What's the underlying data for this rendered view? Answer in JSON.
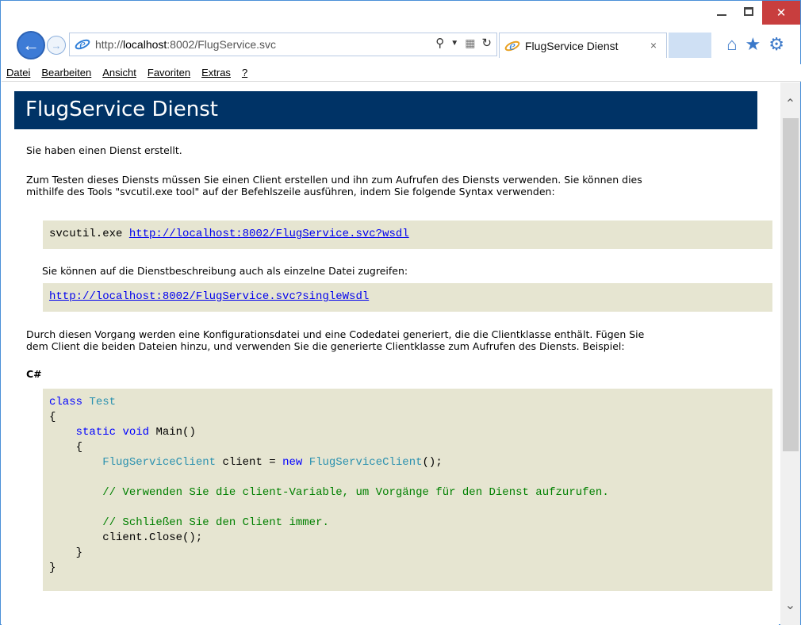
{
  "browser": {
    "address": {
      "prefix": "http://",
      "host": "localhost",
      "rest": ":8002/FlugService.svc"
    },
    "tab_title": "FlugService Dienst",
    "tab_close": "×",
    "menu": [
      "Datei",
      "Bearbeiten",
      "Ansicht",
      "Favoriten",
      "Extras",
      "?"
    ],
    "window_close": "✕"
  },
  "page": {
    "heading": "FlugService Dienst",
    "intro": "Sie haben einen Dienst erstellt.",
    "instructions_line1": "Zum Testen dieses Diensts müssen Sie einen Client erstellen und ihn zum Aufrufen des Diensts verwenden. Sie können dies",
    "instructions_line2": "mithilfe des Tools \"svcutil.exe tool\" auf der Befehlszeile ausführen, indem Sie folgende Syntax verwenden:",
    "svcutil_cmd": "svcutil.exe ",
    "wsdl_link": "http://localhost:8002/FlugService.svc?wsdl",
    "single_file_note": "Sie können auf die Dienstbeschreibung auch als einzelne Datei zugreifen:",
    "single_wsdl_link": "http://localhost:8002/FlugService.svc?singleWsdl",
    "process_line1": "Durch diesen Vorgang werden eine Konfigurationsdatei und eine Codedatei generiert, die die Clientklasse enthält. Fügen Sie",
    "process_line2": "dem Client die beiden Dateien hinzu, und verwenden Sie die generierte Clientklasse zum Aufrufen des Diensts. Beispiel:",
    "lang_label": "C#",
    "code": {
      "kw_class": "class",
      "class_name": "Test",
      "open_brace": "{",
      "kw_static": "static",
      "kw_void": "void",
      "main_sig": "Main()",
      "client_type": "FlugServiceClient",
      "client_decl": " client = ",
      "kw_new": "new",
      "client_ctor_end": "();",
      "comment_use": "// Verwenden Sie die client-Variable, um Vorgänge für den Dienst aufzurufen.",
      "comment_close": "// Schließen Sie den Client immer.",
      "close_call": "client.Close();",
      "close_brace": "}"
    }
  }
}
